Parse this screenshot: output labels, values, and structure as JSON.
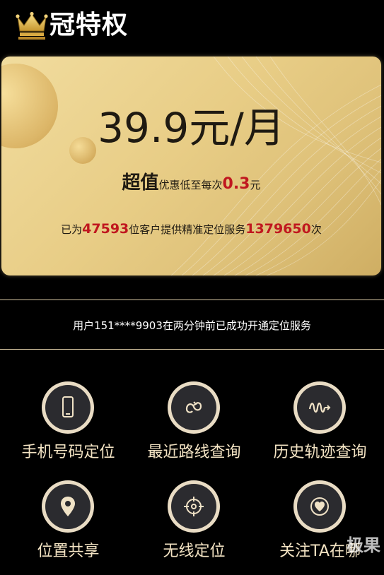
{
  "header": {
    "title": "皇冠特权",
    "title_rest": "冠特权"
  },
  "card": {
    "price": "39.9元/月",
    "deal": {
      "lead": "超值",
      "text": "优惠低至每次",
      "amount": "0.3",
      "unit": "元"
    },
    "served": {
      "prefix": "已为",
      "customers": "47593",
      "middle": "位客户提供精准定位服务",
      "times": "1379650",
      "suffix": "次"
    }
  },
  "notice": {
    "text": "用户151****9903在两分钟前已成功开通定位服务"
  },
  "features": [
    {
      "label": "手机号码定位",
      "icon": "phone-icon"
    },
    {
      "label": "最近路线查询",
      "icon": "route-loop-icon"
    },
    {
      "label": "历史轨迹查询",
      "icon": "track-wave-icon"
    },
    {
      "label": "位置共享",
      "icon": "location-pin-icon"
    },
    {
      "label": "无线定位",
      "icon": "crosshair-icon"
    },
    {
      "label": "关注TA在哪",
      "icon": "heart-icon"
    }
  ],
  "watermark": {
    "text": "极果"
  },
  "colors": {
    "gold": "#e8cd86",
    "accent_red": "#c0171f",
    "label_cream": "#f3e3c3",
    "ring": "#e9dcc4",
    "icon_bg": "#2b2b2f"
  }
}
